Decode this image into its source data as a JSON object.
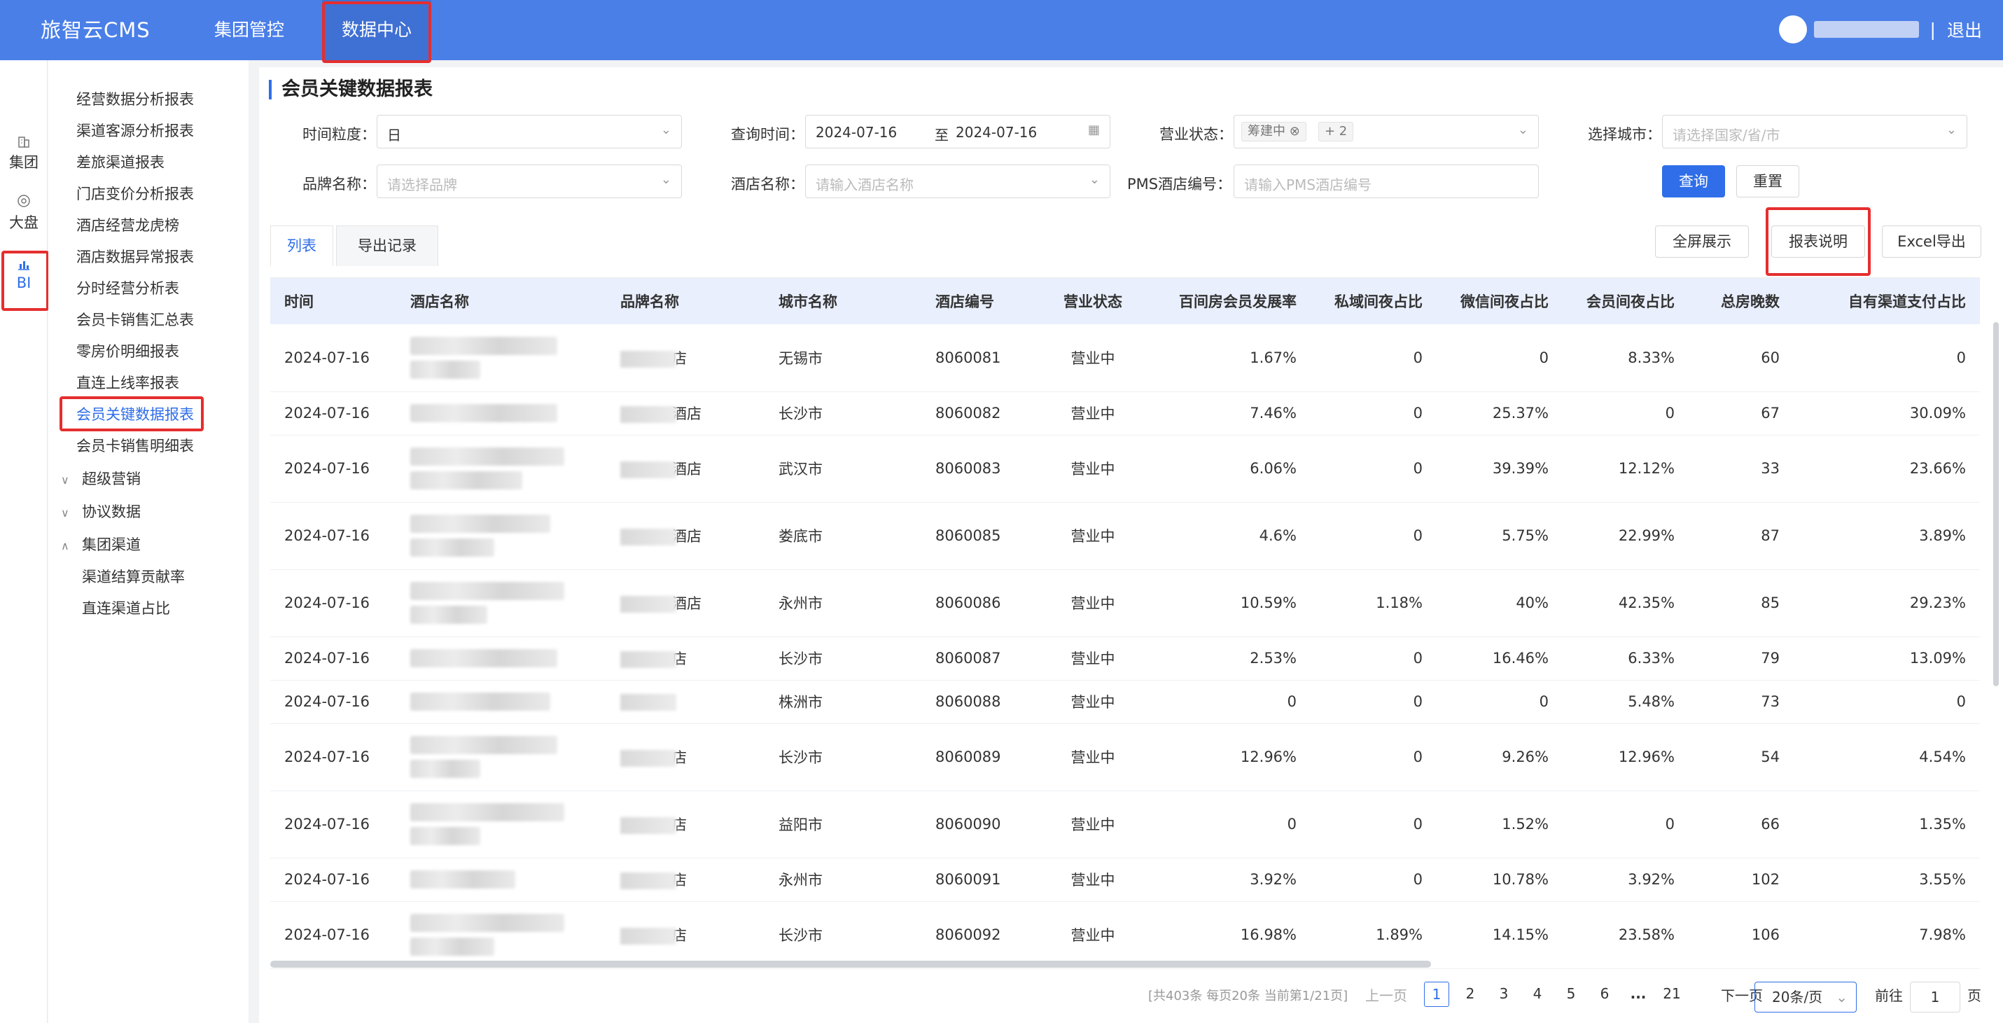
{
  "header": {
    "logo": "旅智云CMS",
    "nav": [
      "集团管控",
      "数据中心"
    ],
    "logout": "退出",
    "separator": "|"
  },
  "rail": [
    {
      "label": "集团",
      "icon": "building-icon"
    },
    {
      "label": "大盘",
      "icon": "target-icon"
    },
    {
      "label": "BI",
      "icon": "bar-chart-icon"
    }
  ],
  "menu": {
    "items": [
      "经营数据分析报表",
      "渠道客源分析报表",
      "差旅渠道报表",
      "门店变价分析报表",
      "酒店经营龙虎榜",
      "酒店数据异常报表",
      "分时经营分析表",
      "会员卡销售汇总表",
      "零房价明细报表",
      "直连上线率报表",
      "会员关键数据报表",
      "会员卡销售明细表"
    ],
    "groups": [
      "超级营销",
      "协议数据",
      "集团渠道"
    ],
    "channel_sub": [
      "渠道结算贡献率",
      "直连渠道占比"
    ]
  },
  "page": {
    "title": "会员关键数据报表"
  },
  "filters": {
    "granularity_label": "时间粒度：",
    "granularity_value": "日",
    "query_time_label": "查询时间：",
    "date_start": "2024-07-16",
    "date_to": "至",
    "date_end": "2024-07-16",
    "status_label": "营业状态：",
    "status_tag": "筹建中",
    "status_more": "+ 2",
    "city_label": "选择城市：",
    "city_placeholder": "请选择国家/省/市",
    "brand_label": "品牌名称：",
    "brand_placeholder": "请选择品牌",
    "hotel_label": "酒店名称：",
    "hotel_placeholder": "请输入酒店名称",
    "pms_label": "PMS酒店编号：",
    "pms_placeholder": "请输入PMS酒店编号",
    "query_btn": "查询",
    "reset_btn": "重置"
  },
  "tabs": [
    "列表",
    "导出记录"
  ],
  "actions": [
    "全屏展示",
    "报表说明",
    "Excel导出"
  ],
  "table": {
    "columns": [
      "时间",
      "酒店名称",
      "品牌名称",
      "城市名称",
      "酒店编号",
      "营业状态",
      "百间房会员发展率",
      "私域间夜占比",
      "微信间夜占比",
      "会员间夜占比",
      "总房晚数",
      "自有渠道支付占比"
    ],
    "rows": [
      {
        "date": "2024-07-16",
        "brand_suffix": "店",
        "city": "无锡市",
        "code": "8060081",
        "status": "营业中",
        "v1": "1.67%",
        "v2": "0",
        "v3": "0",
        "v4": "8.33%",
        "v5": "60",
        "v6": "0"
      },
      {
        "date": "2024-07-16",
        "brand_suffix": "酒店",
        "city": "长沙市",
        "code": "8060082",
        "status": "营业中",
        "v1": "7.46%",
        "v2": "0",
        "v3": "25.37%",
        "v4": "0",
        "v5": "67",
        "v6": "30.09%"
      },
      {
        "date": "2024-07-16",
        "brand_suffix": "酒店",
        "city": "武汉市",
        "code": "8060083",
        "status": "营业中",
        "v1": "6.06%",
        "v2": "0",
        "v3": "39.39%",
        "v4": "12.12%",
        "v5": "33",
        "v6": "23.66%"
      },
      {
        "date": "2024-07-16",
        "brand_suffix": "酒店",
        "city": "娄底市",
        "code": "8060085",
        "status": "营业中",
        "v1": "4.6%",
        "v2": "0",
        "v3": "5.75%",
        "v4": "22.99%",
        "v5": "87",
        "v6": "3.89%"
      },
      {
        "date": "2024-07-16",
        "brand_suffix": "酒店",
        "city": "永州市",
        "code": "8060086",
        "status": "营业中",
        "v1": "10.59%",
        "v2": "1.18%",
        "v3": "40%",
        "v4": "42.35%",
        "v5": "85",
        "v6": "29.23%"
      },
      {
        "date": "2024-07-16",
        "brand_suffix": "店",
        "city": "长沙市",
        "code": "8060087",
        "status": "营业中",
        "v1": "2.53%",
        "v2": "0",
        "v3": "16.46%",
        "v4": "6.33%",
        "v5": "79",
        "v6": "13.09%"
      },
      {
        "date": "2024-07-16",
        "brand_suffix": "",
        "city": "株洲市",
        "code": "8060088",
        "status": "营业中",
        "v1": "0",
        "v2": "0",
        "v3": "0",
        "v4": "5.48%",
        "v5": "73",
        "v6": "0"
      },
      {
        "date": "2024-07-16",
        "brand_suffix": "店",
        "city": "长沙市",
        "code": "8060089",
        "status": "营业中",
        "v1": "12.96%",
        "v2": "0",
        "v3": "9.26%",
        "v4": "12.96%",
        "v5": "54",
        "v6": "4.54%"
      },
      {
        "date": "2024-07-16",
        "brand_suffix": "店",
        "city": "益阳市",
        "code": "8060090",
        "status": "营业中",
        "v1": "0",
        "v2": "0",
        "v3": "1.52%",
        "v4": "0",
        "v5": "66",
        "v6": "1.35%"
      },
      {
        "date": "2024-07-16",
        "brand_suffix": "店",
        "city": "永州市",
        "code": "8060091",
        "status": "营业中",
        "v1": "3.92%",
        "v2": "0",
        "v3": "10.78%",
        "v4": "3.92%",
        "v5": "102",
        "v6": "3.55%"
      },
      {
        "date": "2024-07-16",
        "brand_suffix": "店",
        "city": "长沙市",
        "code": "8060092",
        "status": "营业中",
        "v1": "16.98%",
        "v2": "1.89%",
        "v3": "14.15%",
        "v4": "23.58%",
        "v5": "106",
        "v6": "7.98%"
      }
    ]
  },
  "pagination": {
    "summary": "[共403条 每页20条 当前第1/21页]",
    "prev": "上一页",
    "pages": [
      "1",
      "2",
      "3",
      "4",
      "5",
      "6",
      "...",
      "21"
    ],
    "next": "下一页",
    "page_size": "20条/页",
    "goto_label": "前往",
    "goto_value": "1",
    "page_unit": "页"
  },
  "colors": {
    "header_bg": "#4a7fe8",
    "primary": "#2f6ee8",
    "highlight": "#e52e2e",
    "table_header_bg": "#e9effd"
  }
}
